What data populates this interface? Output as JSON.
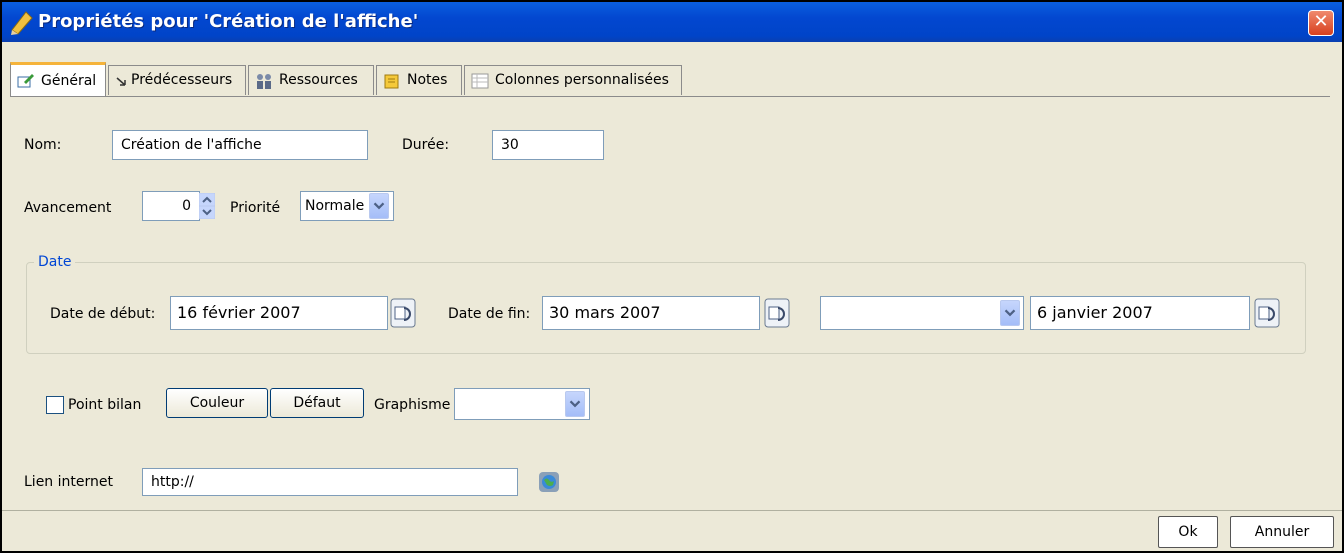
{
  "window": {
    "title": "Propriétés pour 'Création de l'affiche'"
  },
  "tabs": [
    {
      "label": "Général",
      "icon": "edit-icon",
      "active": true
    },
    {
      "label": "Prédécesseurs",
      "icon": "arrow-icon"
    },
    {
      "label": "Ressources",
      "icon": "people-icon"
    },
    {
      "label": "Notes",
      "icon": "notes-icon"
    },
    {
      "label": "Colonnes personnalisées",
      "icon": "table-icon"
    }
  ],
  "general": {
    "nom_label": "Nom:",
    "nom_value": "Création de l'affiche",
    "duree_label": "Durée:",
    "duree_value": "30",
    "avancement_label": "Avancement",
    "avancement_value": "0",
    "priorite_label": "Priorité",
    "priorite_value": "Normale"
  },
  "date": {
    "group_label": "Date",
    "debut_label": "Date de début:",
    "debut_value": "16 février 2007",
    "fin_label": "Date de fin:",
    "fin_value": "30 mars 2007",
    "constraint_value": "",
    "third_value": "6 janvier 2007"
  },
  "options": {
    "point_bilan_label": "Point bilan",
    "point_bilan_checked": false,
    "couleur_label": "Couleur",
    "defaut_label": "Défaut",
    "graphisme_label": "Graphisme",
    "graphisme_value": ""
  },
  "link": {
    "label": "Lien internet",
    "value": "http://"
  },
  "footer": {
    "ok_label": "Ok",
    "cancel_label": "Annuler"
  },
  "colors": {
    "titlebar": "#0347d0",
    "window_bg": "#ece9d8",
    "group_title": "#0046d5",
    "close": "#d8401e"
  }
}
